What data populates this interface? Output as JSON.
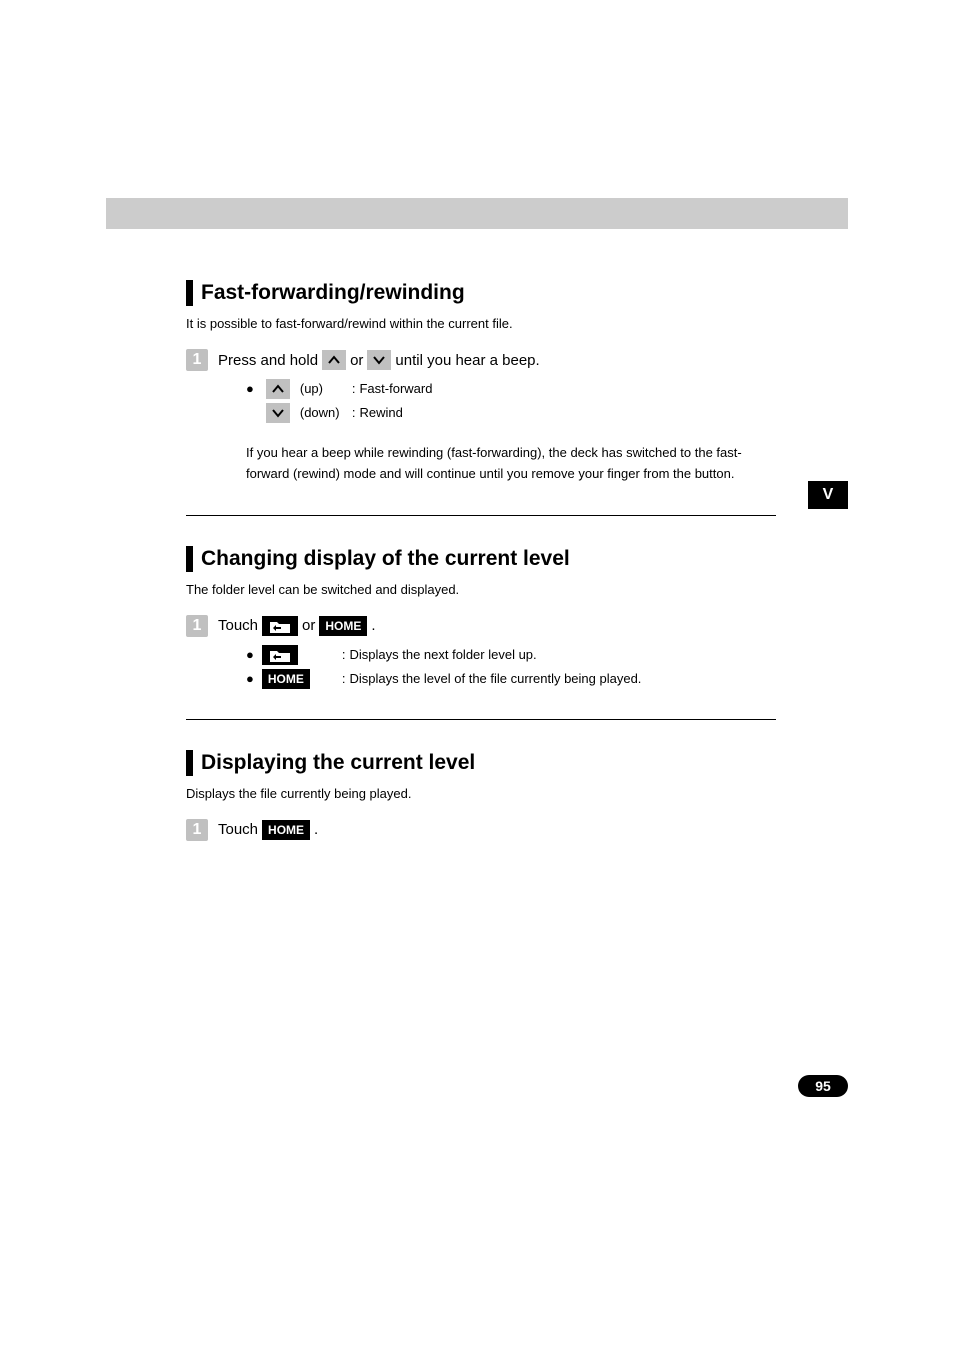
{
  "pageNumber": "95",
  "sideTab": "V",
  "section1": {
    "heading": "Fast-forwarding/rewinding",
    "intro": "It is possible to fast-forward/rewind within the current file.",
    "step": {
      "num": "1",
      "prefix": "Press and hold ",
      "mid": " or ",
      "suffix": " until you hear a beep."
    },
    "bullets": [
      {
        "label": "(up)",
        "sep": ":",
        "desc": "Fast-forward"
      },
      {
        "label": "(down)",
        "sep": ":",
        "desc": "Rewind"
      }
    ],
    "note": "If you hear a beep while rewinding (fast-forwarding), the deck has switched to the fast-forward (rewind) mode and will continue until you remove your finger from the button."
  },
  "section2": {
    "heading": "Changing display of the current level",
    "intro": "The folder level can be switched and displayed.",
    "step": {
      "num": "1",
      "prefix": "Touch ",
      "mid": " or ",
      "homeLabel": "HOME",
      "suffix": " ."
    },
    "bullets": [
      {
        "homeLabel": "",
        "sep": ":",
        "desc": "Displays the next folder level up."
      },
      {
        "homeLabel": "HOME",
        "sep": ":",
        "desc": "Displays the level of the file currently being played."
      }
    ]
  },
  "section3": {
    "heading": "Displaying the current level",
    "intro": "Displays the file currently being played.",
    "step": {
      "num": "1",
      "prefix": "Touch ",
      "homeLabel": "HOME",
      "suffix": " ."
    }
  }
}
